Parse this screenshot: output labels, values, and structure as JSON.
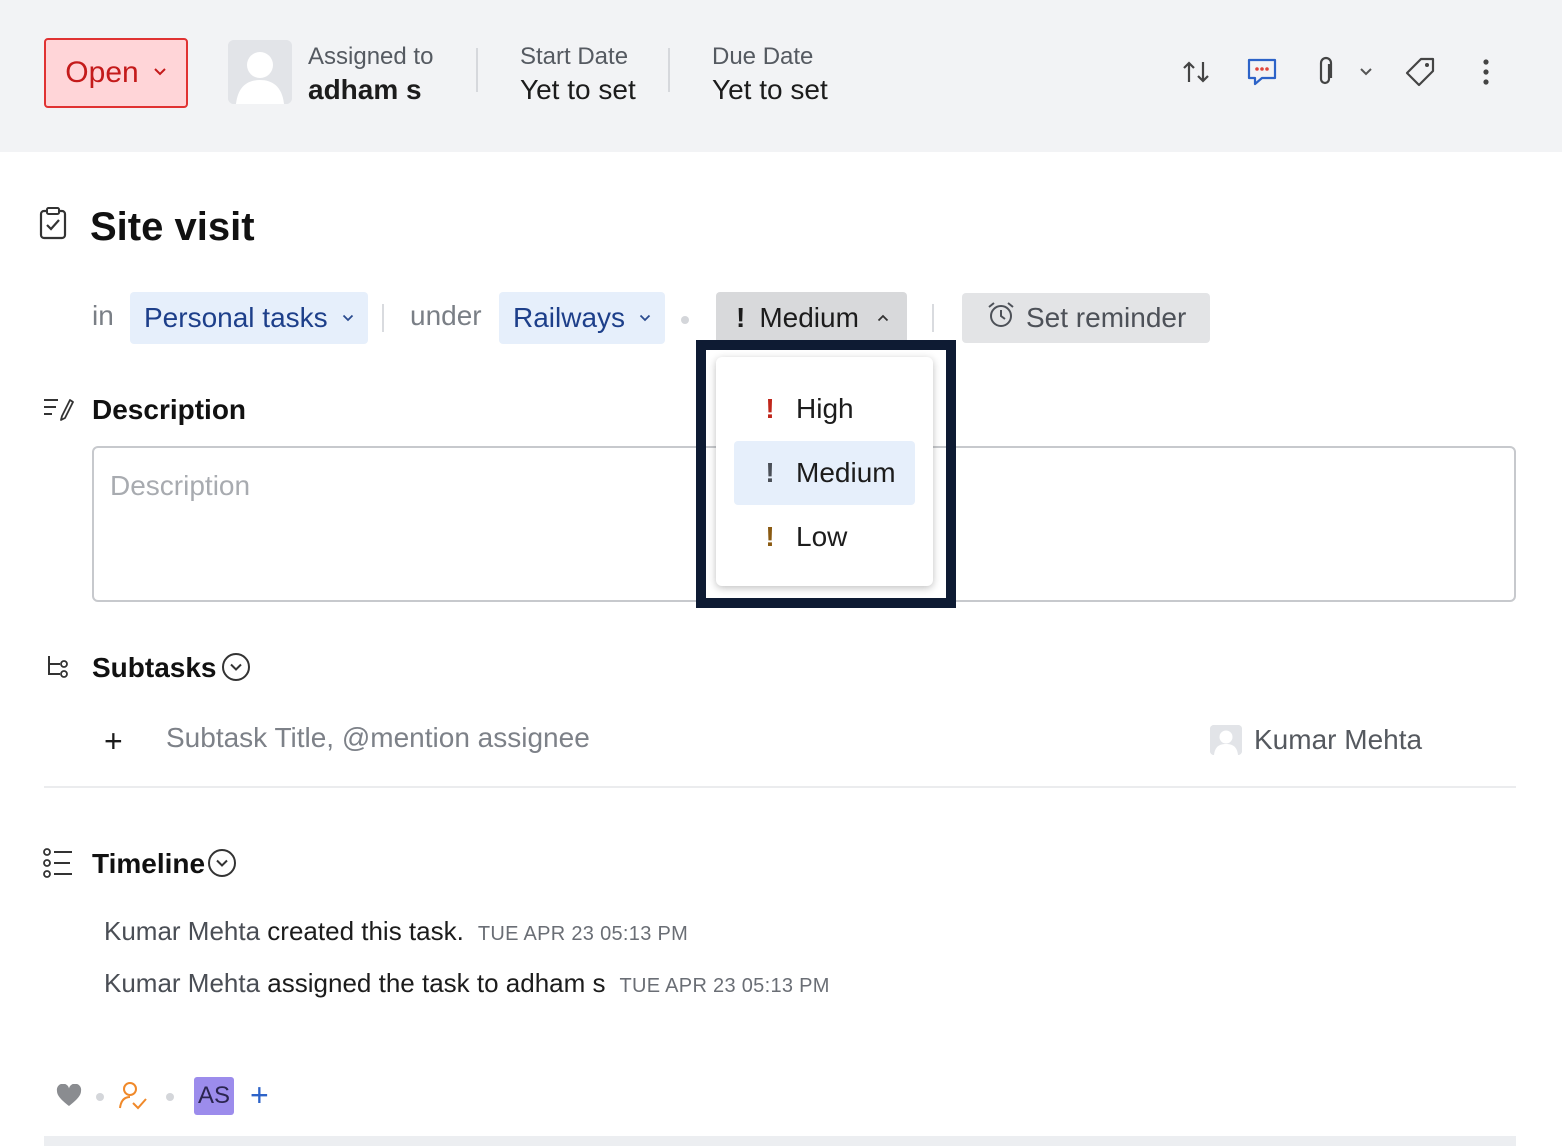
{
  "header": {
    "status": "Open",
    "assigned_label": "Assigned to",
    "assigned_value": "adham s",
    "start_label": "Start Date",
    "start_value": "Yet to set",
    "due_label": "Due Date",
    "due_value": "Yet to set",
    "icons": [
      "swap-icon",
      "comment-icon",
      "attachment-icon",
      "chevron-down-icon",
      "tag-icon",
      "more-vertical-icon"
    ]
  },
  "task": {
    "title": "Site visit",
    "in_label": "in",
    "list": "Personal tasks",
    "under_label": "under",
    "project": "Railways",
    "priority": "Medium",
    "reminder": "Set reminder"
  },
  "priority_menu": {
    "items": [
      {
        "label": "High",
        "color": "#c0261b"
      },
      {
        "label": "Medium",
        "color": "#4a4f57"
      },
      {
        "label": "Low",
        "color": "#8a5a12"
      }
    ],
    "selected": "Medium"
  },
  "description": {
    "title": "Description",
    "placeholder": "Description"
  },
  "subtasks": {
    "title": "Subtasks",
    "placeholder": "Subtask Title, @mention assignee",
    "assignee": "Kumar Mehta"
  },
  "timeline": {
    "title": "Timeline",
    "entries": [
      {
        "actor": "Kumar Mehta",
        "action": " created this task.",
        "time": "TUE APR 23 05:13 PM"
      },
      {
        "actor": "Kumar Mehta",
        "action": " assigned the task to adham s",
        "time": "TUE APR 23 05:13 PM"
      }
    ]
  },
  "footer": {
    "initials": "AS",
    "colors": {
      "like": "#8a8c90",
      "follower": "#f0892a",
      "avatar": "#9c8cec",
      "add": "#2d63c8"
    }
  }
}
